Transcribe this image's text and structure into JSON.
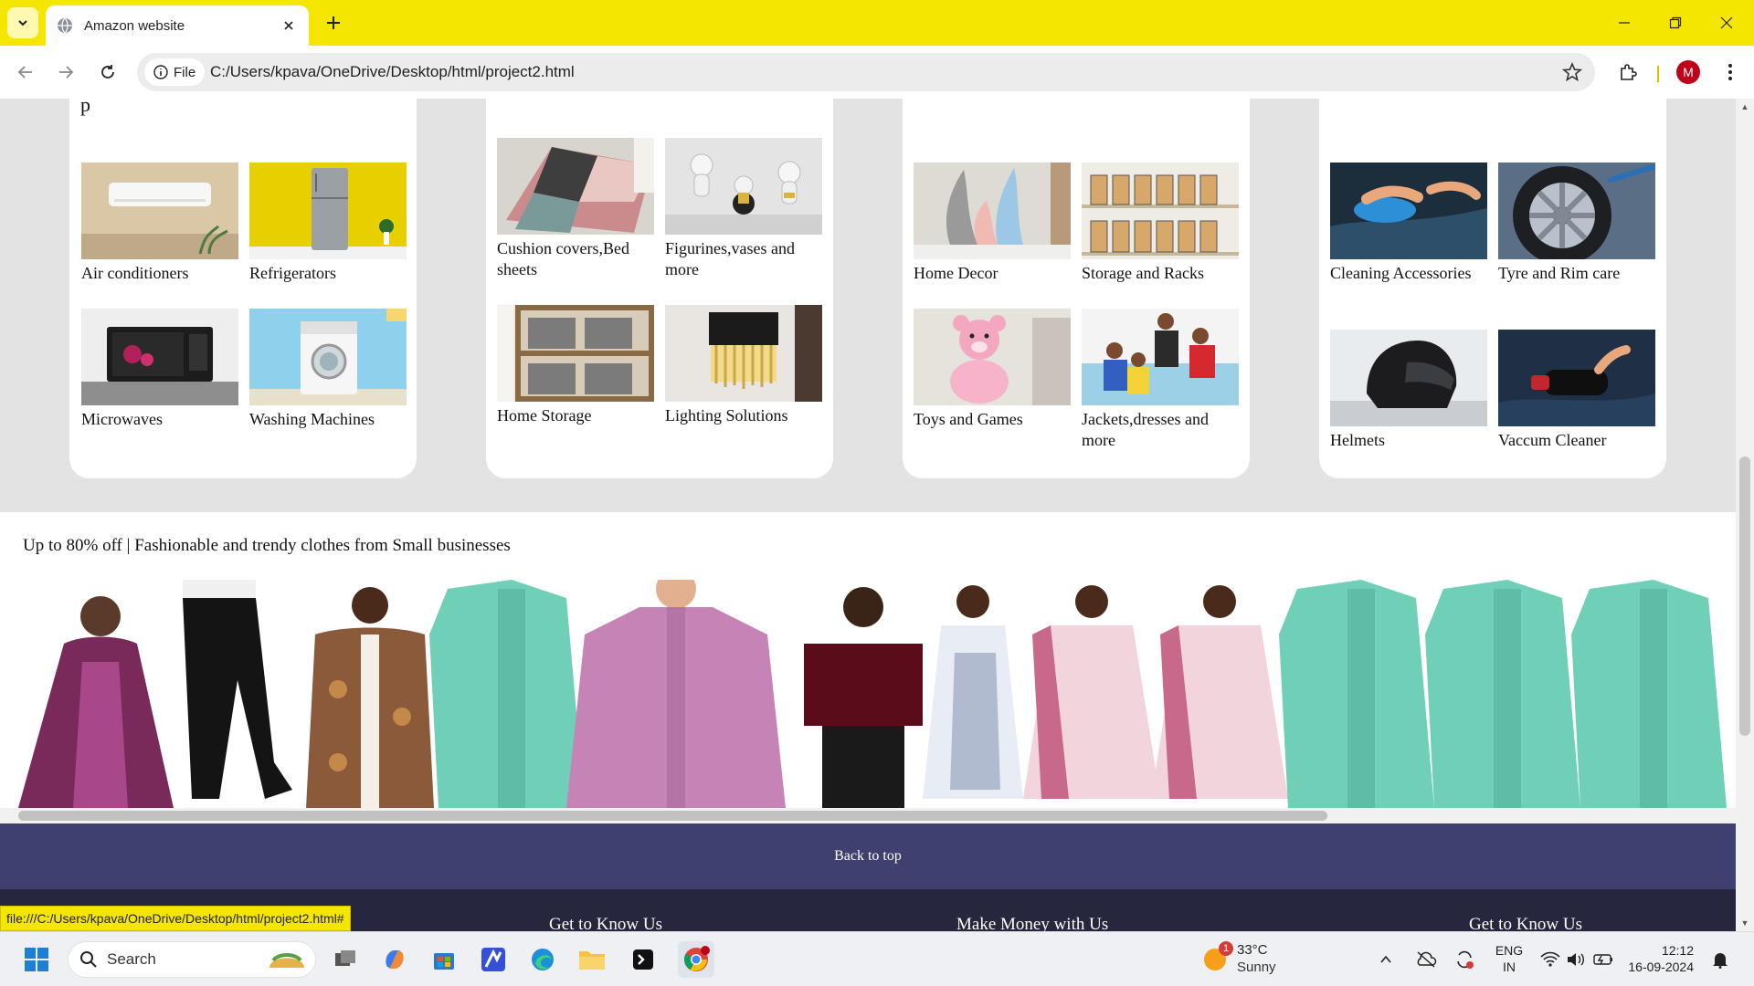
{
  "browser": {
    "tab_title": "Amazon website",
    "site_chip": "File",
    "url": "C:/Users/kpava/OneDrive/Desktop/html/project2.html",
    "profile_initial": "M",
    "status_url": "file:///C:/Users/kpava/OneDrive/Desktop/html/project2.html#"
  },
  "cards": [
    {
      "heading_fragment": "p",
      "items": [
        {
          "label": "Air conditioners"
        },
        {
          "label": "Refrigerators"
        },
        {
          "label": "Microwaves"
        },
        {
          "label": "Washing Machines"
        }
      ]
    },
    {
      "items": [
        {
          "label": "Cushion covers,Bed sheets"
        },
        {
          "label": "Figurines,vases and more"
        },
        {
          "label": "Home Storage"
        },
        {
          "label": "Lighting Solutions"
        }
      ]
    },
    {
      "items": [
        {
          "label": "Home Decor"
        },
        {
          "label": "Storage and Racks"
        },
        {
          "label": "Toys and Games"
        },
        {
          "label": "Jackets,dresses and more"
        }
      ]
    },
    {
      "items": [
        {
          "label": "Cleaning Accessories"
        },
        {
          "label": "Tyre and Rim care"
        },
        {
          "label": "Helmets"
        },
        {
          "label": "Vaccum Cleaner"
        }
      ]
    }
  ],
  "fashion": {
    "title": "Up to 80% off | Fashionable and trendy clothes from Small businesses"
  },
  "back_to_top": "Back to top",
  "footer": {
    "col1": "Get to Know Us",
    "col2": "Make Money with Us",
    "col3": "Get to Know Us"
  },
  "taskbar": {
    "search_placeholder": "Search",
    "weather_temp": "33°C",
    "weather_condition": "Sunny",
    "weather_badge": "1",
    "lang_top": "ENG",
    "lang_bottom": "IN",
    "time": "12:12",
    "date": "16-09-2024"
  },
  "colors": {
    "tabbar": "#f4e600",
    "back_to_top": "#3f4070",
    "footer": "#26273f",
    "avatar": "#c0001a"
  }
}
